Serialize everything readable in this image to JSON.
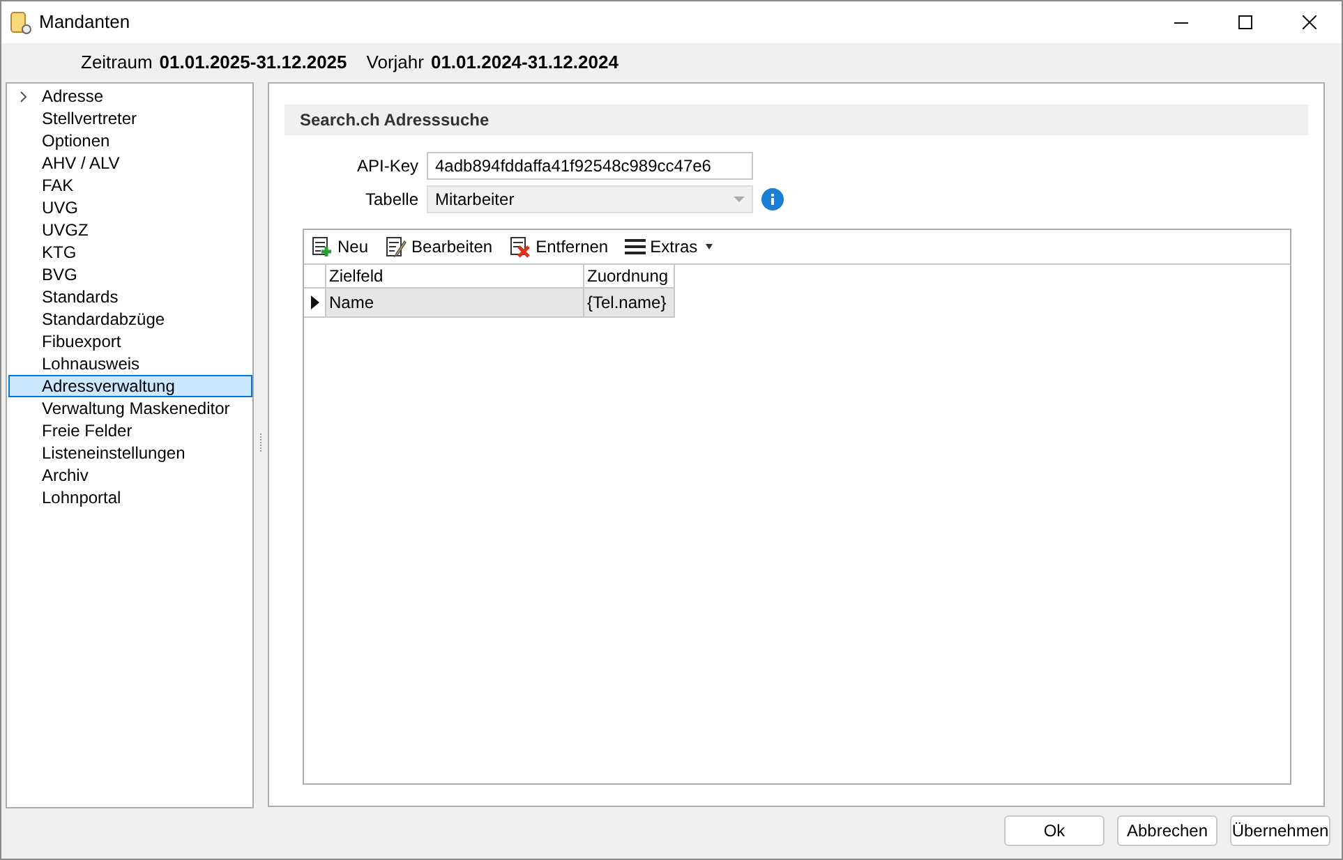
{
  "window": {
    "title": "Mandanten"
  },
  "period": {
    "label": "Zeitraum",
    "value": "01.01.2025-31.12.2025"
  },
  "previous_year": {
    "label": "Vorjahr",
    "value": "01.01.2024-31.12.2024"
  },
  "sidebar": {
    "items": [
      {
        "label": "Adresse",
        "expandable": true,
        "selected": false
      },
      {
        "label": "Stellvertreter",
        "expandable": false,
        "selected": false
      },
      {
        "label": "Optionen",
        "expandable": false,
        "selected": false
      },
      {
        "label": "AHV / ALV",
        "expandable": false,
        "selected": false
      },
      {
        "label": "FAK",
        "expandable": false,
        "selected": false
      },
      {
        "label": "UVG",
        "expandable": false,
        "selected": false
      },
      {
        "label": "UVGZ",
        "expandable": false,
        "selected": false
      },
      {
        "label": "KTG",
        "expandable": false,
        "selected": false
      },
      {
        "label": "BVG",
        "expandable": false,
        "selected": false
      },
      {
        "label": "Standards",
        "expandable": false,
        "selected": false
      },
      {
        "label": "Standardabzüge",
        "expandable": false,
        "selected": false
      },
      {
        "label": "Fibuexport",
        "expandable": false,
        "selected": false
      },
      {
        "label": "Lohnausweis",
        "expandable": false,
        "selected": false
      },
      {
        "label": "Adressverwaltung",
        "expandable": false,
        "selected": true
      },
      {
        "label": "Verwaltung Maskeneditor",
        "expandable": false,
        "selected": false
      },
      {
        "label": "Freie Felder",
        "expandable": false,
        "selected": false
      },
      {
        "label": "Listeneinstellungen",
        "expandable": false,
        "selected": false
      },
      {
        "label": "Archiv",
        "expandable": false,
        "selected": false
      },
      {
        "label": "Lohnportal",
        "expandable": false,
        "selected": false
      }
    ]
  },
  "section": {
    "title": "Search.ch Adresssuche"
  },
  "api_key": {
    "label": "API-Key",
    "value": "4adb894fddaffa41f92548c989cc47e6"
  },
  "table_select": {
    "label": "Tabelle",
    "value": "Mitarbeiter",
    "disabled": true
  },
  "toolbar": [
    {
      "kind": "new",
      "label": "Neu"
    },
    {
      "kind": "edit",
      "label": "Bearbeiten"
    },
    {
      "kind": "delete",
      "label": "Entfernen"
    },
    {
      "kind": "menu",
      "label": "Extras"
    }
  ],
  "table": {
    "columns": [
      "Zielfeld",
      "Zuordnung"
    ],
    "rows": [
      {
        "cells": [
          "Name",
          "{Tel.name}"
        ],
        "selected": true
      }
    ]
  },
  "buttons": [
    "Ok",
    "Abbrechen",
    "Übernehmen"
  ]
}
